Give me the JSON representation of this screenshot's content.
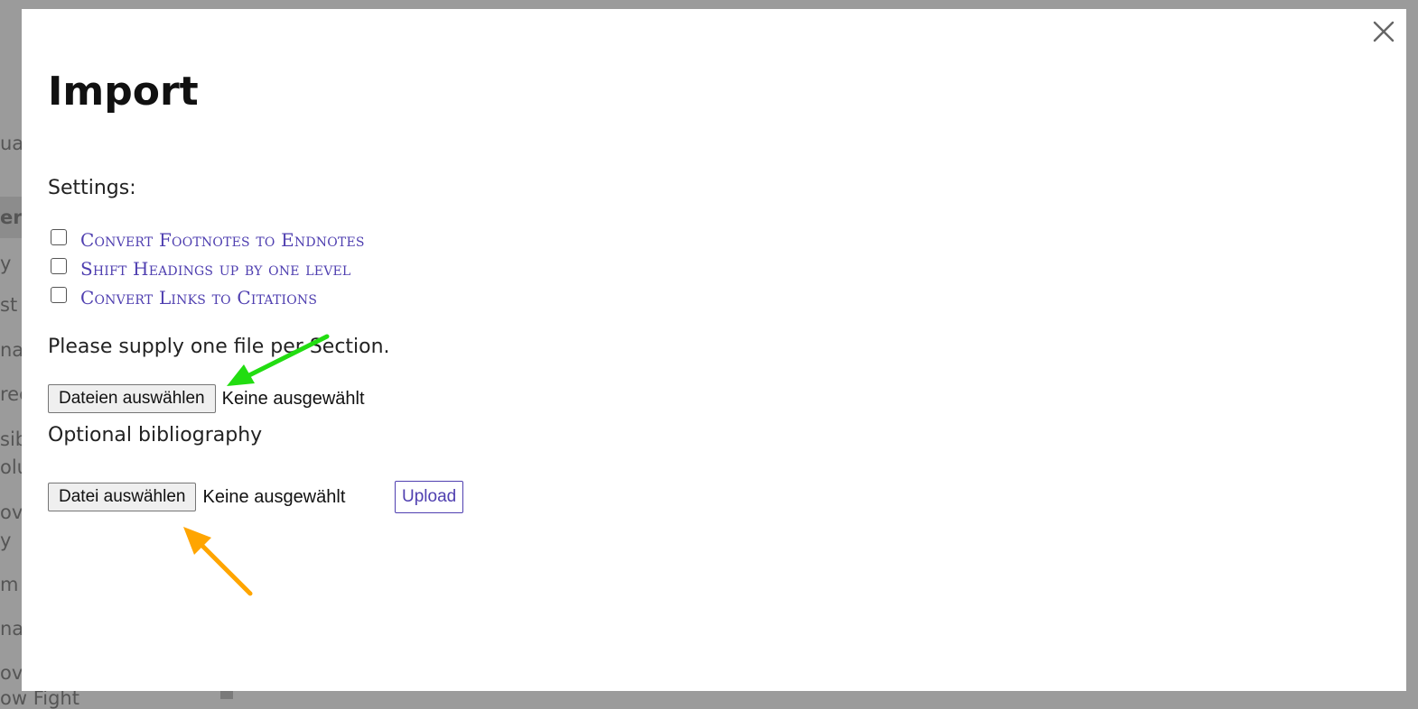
{
  "background": {
    "sidebar_fragments": [
      "ua",
      "er",
      "y",
      "st",
      "na",
      "rec",
      "sib",
      "olu",
      "ov",
      "y",
      "m",
      "nal",
      "ovi",
      "ow Fight"
    ]
  },
  "modal": {
    "title": "Import",
    "settings_label": "Settings:",
    "options": [
      {
        "label": "Convert Footnotes to Endnotes",
        "checked": false
      },
      {
        "label": "Shift Headings up by one level",
        "checked": false
      },
      {
        "label": "Convert Links to Citations",
        "checked": false
      }
    ],
    "supply_text": "Please supply one file per Section.",
    "sections_file": {
      "button_label": "Dateien auswählen",
      "status": "Keine ausgewählt"
    },
    "bibliography_label": "Optional bibliography",
    "bibliography_file": {
      "button_label": "Datei auswählen",
      "status": "Keine ausgewählt"
    },
    "upload_label": "Upload",
    "close_icon": "close-icon"
  },
  "annotations": {
    "green_arrow_color": "#22dd11",
    "orange_arrow_color": "#ffa500"
  },
  "colors": {
    "accent": "#4f3fb0",
    "overlay": "#9b9b9b"
  }
}
